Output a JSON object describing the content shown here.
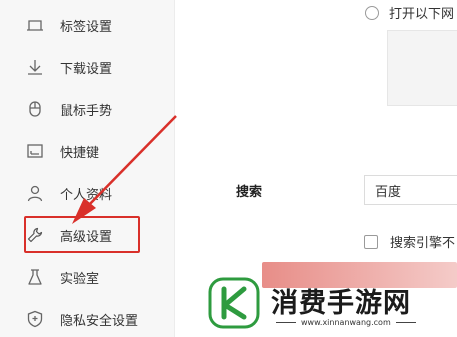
{
  "sidebar": {
    "items": [
      {
        "label": "标签设置",
        "icon": "tab-icon"
      },
      {
        "label": "下载设置",
        "icon": "download-icon"
      },
      {
        "label": "鼠标手势",
        "icon": "mouse-icon"
      },
      {
        "label": "快捷键",
        "icon": "keyboard-icon"
      },
      {
        "label": "个人资料",
        "icon": "person-icon"
      },
      {
        "label": "高级设置",
        "icon": "wrench-icon"
      },
      {
        "label": "实验室",
        "icon": "flask-icon"
      },
      {
        "label": "隐私安全设置",
        "icon": "shield-icon"
      }
    ]
  },
  "main": {
    "startup_radio_label": "打开以下网",
    "search": {
      "label": "搜索",
      "engine_value": "百度",
      "engine_checkbox_label": "搜索引擎不"
    }
  },
  "watermark": {
    "brand": "消费手游网",
    "url": "www.xinnanwang.com"
  },
  "colors": {
    "highlight_red": "#d9302a",
    "logo_green": "#2e9b3f"
  }
}
